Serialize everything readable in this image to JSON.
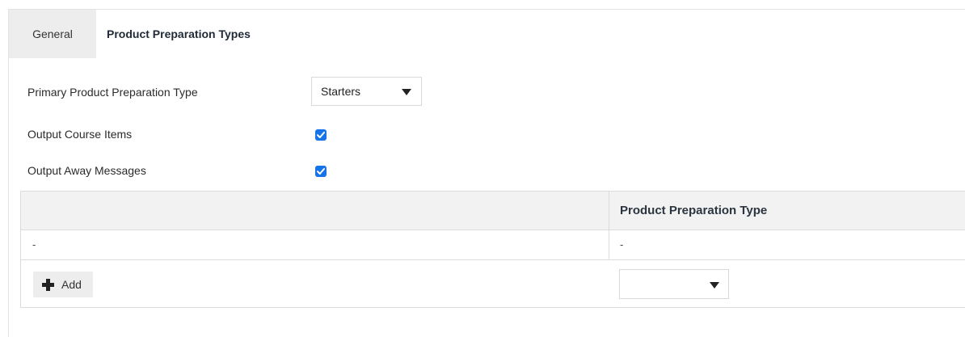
{
  "tabs": [
    {
      "label": "General"
    },
    {
      "label": "Product Preparation Types"
    }
  ],
  "form": {
    "primary_label": "Primary Product Preparation Type",
    "primary_value": "Starters",
    "course_items_label": "Output Course Items",
    "course_items_checked": true,
    "away_messages_label": "Output Away Messages",
    "away_messages_checked": true
  },
  "table": {
    "header": "Product Preparation Type",
    "rows": [
      {
        "left": "-",
        "right": "-"
      }
    ],
    "add_label": "Add",
    "new_value": ""
  },
  "colors": {
    "accent": "#1674e8",
    "tab_inactive_bg": "#ededed",
    "table_header_bg": "#f2f2f2"
  }
}
